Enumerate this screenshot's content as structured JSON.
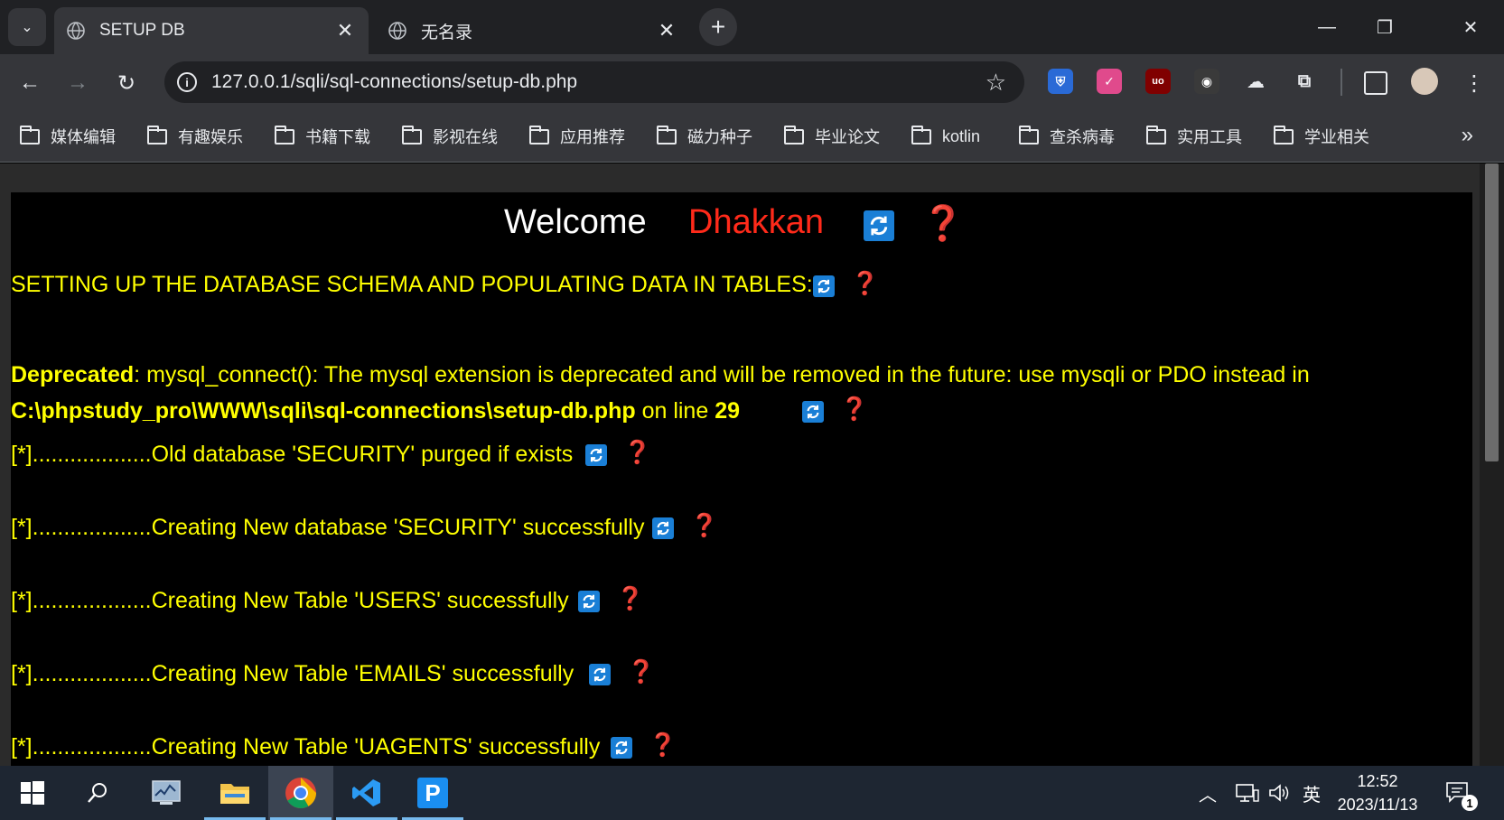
{
  "browser": {
    "tabs": [
      {
        "title": "SETUP DB",
        "active": true
      },
      {
        "title": "无名录",
        "active": false
      }
    ],
    "url": "127.0.0.1/sqli/sql-connections/setup-db.php",
    "bookmarks": [
      "媒体编辑",
      "有趣娱乐",
      "书籍下载",
      "影视在线",
      "应用推荐",
      "磁力种子",
      "毕业论文",
      "kotlin",
      "查杀病毒",
      "实用工具",
      "学业相关"
    ],
    "icons": {
      "back": "←",
      "forward": "→",
      "reload": "↻",
      "star": "☆",
      "minimize": "—",
      "restore": "❐",
      "close": "✕",
      "more": "⋮",
      "chevron": "⌄",
      "bookmarks_more": "»",
      "newtab": "+",
      "tabclose": "✕"
    }
  },
  "page": {
    "welcome": "Welcome",
    "name": "Dhakkan",
    "heading": "SETTING UP THE DATABASE SCHEMA AND POPULATING DATA IN TABLES:",
    "deprecated_label": "Deprecated",
    "deprecated_msg": ": mysql_connect(): The mysql extension is deprecated and will be removed in the future: use mysqli or PDO instead in",
    "deprecated_path": "C:\\phpstudy_pro\\WWW\\sqli\\sql-connections\\setup-db.php",
    "on_line": " on line ",
    "line_no": "29",
    "question": "❓",
    "steps": [
      "[*]...................Old database 'SECURITY' purged if exists",
      "[*]...................Creating New database 'SECURITY' successfully",
      "[*]...................Creating New Table 'USERS' successfully",
      "[*]...................Creating New Table 'EMAILS' successfully",
      "[*]...................Creating New Table 'UAGENTS' successfully"
    ]
  },
  "taskbar": {
    "apps": [
      "windows-start",
      "search",
      "task-manager",
      "file-explorer",
      "chrome",
      "vscode",
      "phpstudy"
    ],
    "ime": "英",
    "time": "12:52",
    "date": "2023/11/13",
    "notifications": "1"
  },
  "colors": {
    "page_text": "#ffff00",
    "name": "#ff2a1a",
    "emoji_blue": "#1a7fd6",
    "chrome_dark": "#202124",
    "chrome_toolbar": "#35363a"
  }
}
